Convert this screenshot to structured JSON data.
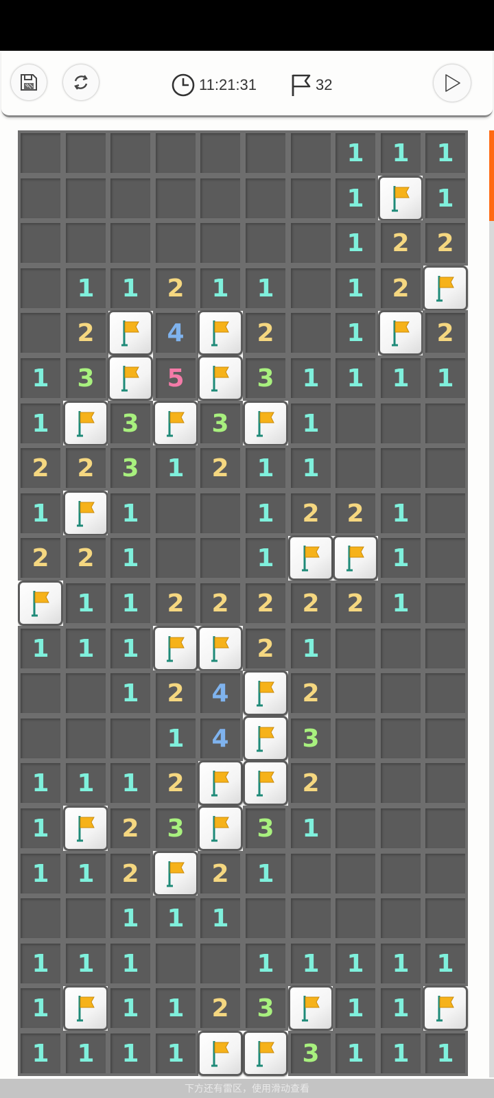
{
  "toolbar": {
    "timer": "11:21:31",
    "flag_count": "32",
    "icons": [
      "save-icon",
      "restart-icon",
      "clock-icon",
      "flag-outline-icon",
      "play-icon"
    ]
  },
  "board": {
    "columns": 10,
    "legend": "F = flagged cell, 0 = revealed empty cell, digit = adjacent mine count",
    "rows": [
      [
        "0",
        "0",
        "0",
        "0",
        "0",
        "0",
        "0",
        "1",
        "1",
        "1"
      ],
      [
        "0",
        "0",
        "0",
        "0",
        "0",
        "0",
        "0",
        "1",
        "F",
        "1"
      ],
      [
        "0",
        "0",
        "0",
        "0",
        "0",
        "0",
        "0",
        "1",
        "2",
        "2"
      ],
      [
        "0",
        "1",
        "1",
        "2",
        "1",
        "1",
        "0",
        "1",
        "2",
        "F"
      ],
      [
        "0",
        "2",
        "F",
        "4",
        "F",
        "2",
        "0",
        "1",
        "F",
        "2"
      ],
      [
        "1",
        "3",
        "F",
        "5",
        "F",
        "3",
        "1",
        "1",
        "1",
        "1"
      ],
      [
        "1",
        "F",
        "3",
        "F",
        "3",
        "F",
        "1",
        "0",
        "0",
        "0"
      ],
      [
        "2",
        "2",
        "3",
        "1",
        "2",
        "1",
        "1",
        "0",
        "0",
        "0"
      ],
      [
        "1",
        "F",
        "1",
        "0",
        "0",
        "1",
        "2",
        "2",
        "1",
        "0"
      ],
      [
        "2",
        "2",
        "1",
        "0",
        "0",
        "1",
        "F",
        "F",
        "1",
        "0"
      ],
      [
        "F",
        "1",
        "1",
        "2",
        "2",
        "2",
        "2",
        "2",
        "1",
        "0"
      ],
      [
        "1",
        "1",
        "1",
        "F",
        "F",
        "2",
        "1",
        "0",
        "0",
        "0"
      ],
      [
        "0",
        "0",
        "1",
        "2",
        "4",
        "F",
        "2",
        "0",
        "0",
        "0"
      ],
      [
        "0",
        "0",
        "0",
        "1",
        "4",
        "F",
        "3",
        "0",
        "0",
        "0"
      ],
      [
        "1",
        "1",
        "1",
        "2",
        "F",
        "F",
        "2",
        "0",
        "0",
        "0"
      ],
      [
        "1",
        "F",
        "2",
        "3",
        "F",
        "3",
        "1",
        "0",
        "0",
        "0"
      ],
      [
        "1",
        "1",
        "2",
        "F",
        "2",
        "1",
        "0",
        "0",
        "0",
        "0"
      ],
      [
        "0",
        "0",
        "1",
        "1",
        "1",
        "0",
        "0",
        "0",
        "0",
        "0"
      ],
      [
        "1",
        "1",
        "1",
        "0",
        "0",
        "1",
        "1",
        "1",
        "1",
        "1"
      ],
      [
        "1",
        "F",
        "1",
        "1",
        "2",
        "3",
        "F",
        "1",
        "1",
        "F"
      ],
      [
        "1",
        "1",
        "1",
        "1",
        "F",
        "F",
        "3",
        "1",
        "1",
        "1"
      ]
    ]
  },
  "colors": {
    "cell_bg": "#5b5b5b",
    "grid_line": "#6e6e6e",
    "n1": "#7ff0dc",
    "n2": "#f5d780",
    "n3": "#a8f07e",
    "n4": "#7fb3ee",
    "n5": "#f47ba8",
    "scroll_thumb": "#ff6a13"
  },
  "hint": "下方还有雷区，使用滑动查看"
}
